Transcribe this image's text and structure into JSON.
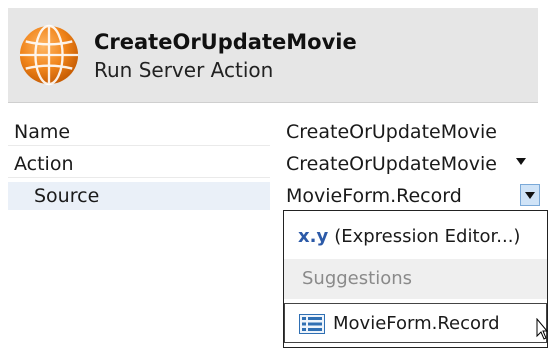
{
  "header": {
    "title": "CreateOrUpdateMovie",
    "subtitle": "Run Server Action",
    "icon": "globe-icon",
    "accent": "#f28a1e"
  },
  "properties": [
    {
      "label": "Name",
      "value": "CreateOrUpdateMovie"
    },
    {
      "label": "Action",
      "value": "CreateOrUpdateMovie"
    },
    {
      "label": "Source",
      "value": "MovieForm.Record"
    }
  ],
  "popup": {
    "expression_prefix": "x.y",
    "expression_label": "(Expression Editor...)",
    "section_label": "Suggestions",
    "items": [
      {
        "label": "MovieForm.Record",
        "icon": "record-icon"
      }
    ]
  }
}
